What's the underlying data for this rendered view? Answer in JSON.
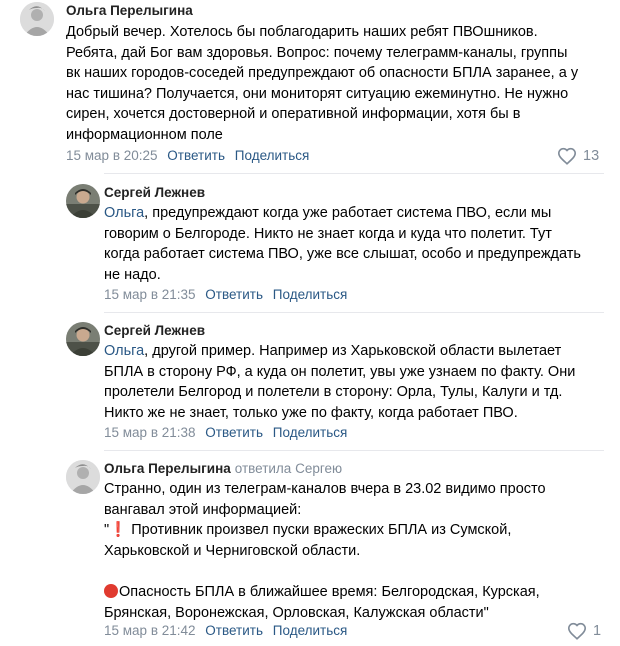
{
  "comments": [
    {
      "author": "Ольга Перелыгина",
      "reply_to": "",
      "lines": [
        "Добрый вечер. Хотелось бы поблагодарить наших ребят ПВОшников.",
        "Ребята, дай Бог вам здоровья. Вопрос: почему телеграмм-каналы, группы",
        "вк наших городов-соседей предупреждают об опасности БПЛА заранее, а у",
        "нас тишина? Получается, они мониторят ситуацию ежеминутно. Не нужно",
        "сирен, хочется достоверной и оперативной информации, хотя бы в",
        "информационном поле"
      ],
      "time": "15 мар в 20:25",
      "reply_label": "Ответить",
      "share_label": "Поделиться",
      "likes": "13"
    },
    {
      "author": "Сергей Лежнев",
      "mention": "Ольга",
      "lines": [
        ", предупреждают когда уже работает система ПВО, если мы",
        "говорим о Белгороде. Никто не знает когда и куда что полетит. Тут",
        "когда работает система ПВО, уже все слышат, особо и предупреждать",
        "не надо."
      ],
      "time": "15 мар в 21:35",
      "reply_label": "Ответить",
      "share_label": "Поделиться"
    },
    {
      "author": "Сергей Лежнев",
      "mention": "Ольга",
      "lines": [
        ", другой пример. Например из Харьковской области вылетает",
        "БПЛА в сторону РФ, а куда он полетит, увы уже узнаем по факту. Они",
        "пролетели Белгород и полетели в сторону: Орла, Тулы, Калуги и тд.",
        "Никто же не знает, только уже по факту, когда работает ПВО."
      ],
      "time": "15 мар в 21:38",
      "reply_label": "Ответить",
      "share_label": "Поделиться"
    },
    {
      "author": "Ольга Перелыгина",
      "reply_to": "ответила Сергею",
      "lines": [
        "Странно, один из телеграм-каналов вчера в 23.02 видимо просто",
        "вангавал этой информацией:",
        "\"",
        " Противник произвел пуски вражеских БПЛА из Сумской,",
        "Харьковской и Черниговской области.",
        "",
        "Опасность БПЛА в ближайшее время: Белгородская, Курская,",
        "Брянская, Воронежская, Орловская, Калужская области\""
      ],
      "time": "15 мар в 21:42",
      "reply_label": "Ответить",
      "share_label": "Поделиться",
      "likes": "1"
    }
  ],
  "colors": {
    "link": "#2a5885",
    "meta": "#818c99",
    "divider": "#e7e8ec"
  },
  "icons": {
    "like": "heart-outline-icon",
    "exclamation": "red-exclamation-emoji",
    "circle": "red-circle-emoji"
  }
}
